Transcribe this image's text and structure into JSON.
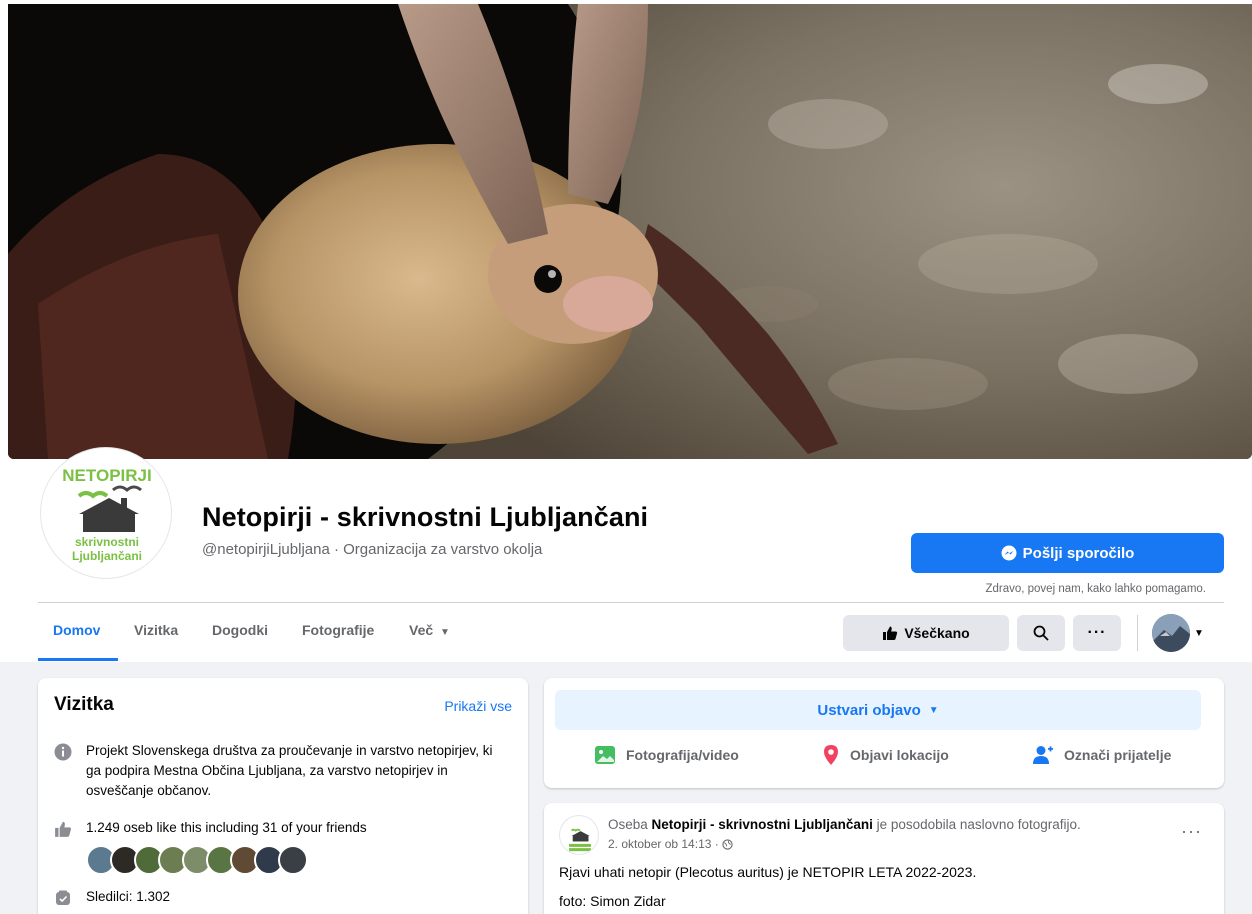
{
  "page": {
    "title": "Netopirji - skrivnostni Ljubljančani",
    "subtitle": "@netopirjiLjubljana · Organizacija za varstvo okolja",
    "logo_text_top": "NETOPIRJI",
    "logo_text_mid": "skrivnostni",
    "logo_text_bottom": "Ljubljančani"
  },
  "message": {
    "button_label": "Pošlji sporočilo",
    "hint": "Zdravo, povej nam, kako lahko pomagamo."
  },
  "tabs": [
    {
      "label": "Domov",
      "active": true
    },
    {
      "label": "Vizitka"
    },
    {
      "label": "Dogodki"
    },
    {
      "label": "Fotografije"
    },
    {
      "label": "Več"
    }
  ],
  "toolbar": {
    "like_label": "Všečkano"
  },
  "about": {
    "title": "Vizitka",
    "show_all": "Prikaži vse",
    "description": "Projekt Slovenskega društva za proučevanje in varstvo netopirjev, ki ga podpira Mestna Občina Ljubljana, za varstvo netopirjev in osveščanje občanov.",
    "likes": "1.249 oseb like this including 31 of your friends",
    "followers": "Sledilci: 1.302"
  },
  "create_post": {
    "button_label": "Ustvari objavo",
    "actions": [
      {
        "label": "Fotografija/video",
        "icon": "photo-icon"
      },
      {
        "label": "Objavi lokacijo",
        "icon": "location-pin-icon"
      },
      {
        "label": "Označi prijatelje",
        "icon": "tag-friends-icon"
      }
    ]
  },
  "post": {
    "prefix": "Oseba",
    "author": "Netopirji - skrivnostni Ljubljančani",
    "action": "je posodobila naslovno fotografijo.",
    "time": "2. oktober ob 14:13 ·",
    "text1": "Rjavi uhati netopir (Plecotus auritus) je NETOPIR LETA 2022-2023.",
    "text2": "foto: Simon Zidar"
  },
  "colors": {
    "accent": "#1877f2",
    "accent_light": "#e7f3ff",
    "text_secondary": "#65676b",
    "background": "#f0f2f5"
  }
}
